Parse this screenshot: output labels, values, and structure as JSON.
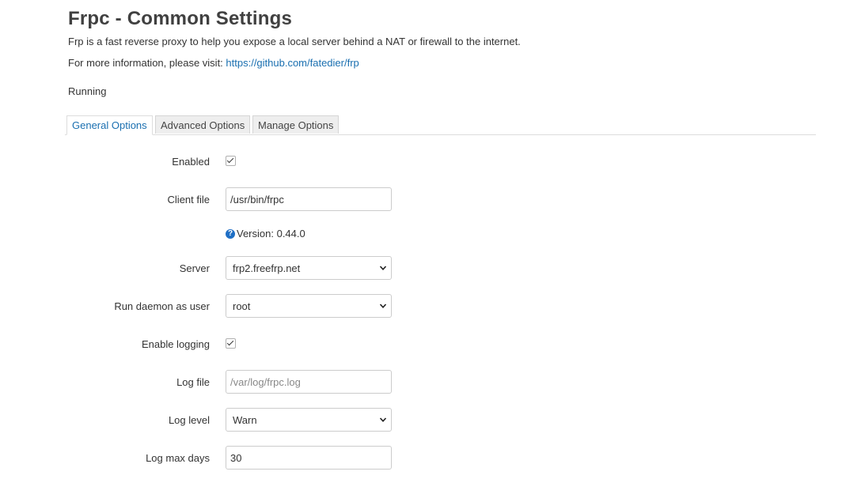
{
  "header": {
    "title": "Frpc - Common Settings",
    "description": "Frp is a fast reverse proxy to help you expose a local server behind a NAT or firewall to the internet.",
    "info_prefix": "For more information, please visit: ",
    "info_link": "https://github.com/fatedier/frp",
    "status": "Running"
  },
  "tabs": [
    {
      "label": "General Options",
      "active": true
    },
    {
      "label": "Advanced Options",
      "active": false
    },
    {
      "label": "Manage Options",
      "active": false
    }
  ],
  "form": {
    "enabled": {
      "label": "Enabled",
      "checked": true
    },
    "client_file": {
      "label": "Client file",
      "value": "/usr/bin/frpc"
    },
    "version_note": "Version: 0.44.0",
    "server": {
      "label": "Server",
      "value": "frp2.freefrp.net"
    },
    "run_user": {
      "label": "Run daemon as user",
      "value": "root"
    },
    "enable_logging": {
      "label": "Enable logging",
      "checked": true
    },
    "log_file": {
      "label": "Log file",
      "placeholder": "/var/log/frpc.log"
    },
    "log_level": {
      "label": "Log level",
      "value": "Warn"
    },
    "log_max_days": {
      "label": "Log max days",
      "value": "30"
    }
  },
  "icons": {
    "help": "question-circle-icon",
    "chevron": "chevron-down-icon",
    "check": "checkmark-icon"
  },
  "colors": {
    "accent": "#1a6fb0",
    "help_icon": "#1f6fc5",
    "tab_inactive_bg": "#eeeeee"
  }
}
